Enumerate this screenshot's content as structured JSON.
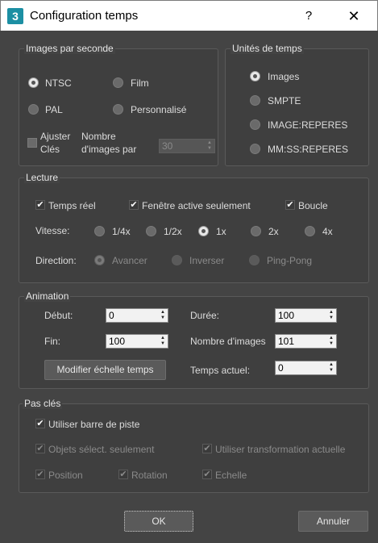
{
  "window": {
    "title": "Configuration temps",
    "icon_text": "3",
    "help": "?",
    "close": "✕"
  },
  "fps": {
    "title": "Images par seconde",
    "ntsc": "NTSC",
    "film": "Film",
    "pal": "PAL",
    "custom": "Personnalisé",
    "adjust_keys_line1": "Ajuster",
    "adjust_keys_line2": "Clés",
    "frame_count_line1": "Nombre",
    "frame_count_line2": "d'images par",
    "frame_count_value": "30",
    "selected": "NTSC"
  },
  "time_units": {
    "title": "Unités de temps",
    "images": "Images",
    "smpte": "SMPTE",
    "image_reperes": "IMAGE:REPERES",
    "mmss_reperes": "MM:SS:REPERES",
    "selected": "Images"
  },
  "playback": {
    "title": "Lecture",
    "real_time": "Temps réel",
    "active_window_only": "Fenêtre active seulement",
    "loop": "Boucle",
    "speed_label": "Vitesse:",
    "speeds": [
      "1/4x",
      "1/2x",
      "1x",
      "2x",
      "4x"
    ],
    "speed_selected": "1x",
    "direction_label": "Direction:",
    "directions": [
      "Avancer",
      "Inverser",
      "Ping-Pong"
    ],
    "direction_selected": "Avancer"
  },
  "animation": {
    "title": "Animation",
    "start_label": "Début:",
    "start_value": "0",
    "end_label": "Fin:",
    "end_value": "100",
    "length_label": "Durée:",
    "length_value": "100",
    "frame_count_label": "Nombre d'images",
    "frame_count_value": "101",
    "current_time_label": "Temps actuel:",
    "current_time_value": "0",
    "rescale_button": "Modifier échelle temps"
  },
  "key_steps": {
    "title": "Pas clés",
    "use_trackbar": "Utiliser barre de piste",
    "selected_objects_only": "Objets sélect. seulement",
    "use_current_transform": "Utiliser transformation actuelle",
    "position": "Position",
    "rotation": "Rotation",
    "scale": "Echelle"
  },
  "footer": {
    "ok": "OK",
    "cancel": "Annuler"
  },
  "colors": {
    "background": "#444444",
    "group_border": "#5a5a5a",
    "text": "#dcdcdc",
    "disabled_text": "#8a8a8a"
  }
}
